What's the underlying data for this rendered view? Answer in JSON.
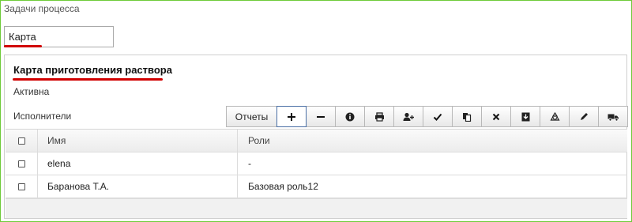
{
  "section": {
    "title": "Задачи процесса"
  },
  "search": {
    "value": "Карта"
  },
  "card": {
    "title": "Карта приготовления раствора",
    "status": "Активна",
    "executors_label": "Исполнители"
  },
  "toolbar": {
    "reports_label": "Отчеты",
    "icons": [
      "plus-icon",
      "minus-icon",
      "info-icon",
      "print-icon",
      "add-user-icon",
      "check-icon",
      "copy-icon",
      "close-icon",
      "archive-icon",
      "recycle-icon",
      "pencil-icon",
      "truck-icon"
    ]
  },
  "table": {
    "columns": [
      "Имя",
      "Роли"
    ],
    "rows": [
      {
        "name": "elena",
        "roles": "-"
      },
      {
        "name": "Баранова Т.А.",
        "roles": "Базовая роль12"
      }
    ]
  },
  "colors": {
    "underline": "#d10000",
    "frame": "#6ecb3a",
    "active_border": "#4a6fa5"
  }
}
